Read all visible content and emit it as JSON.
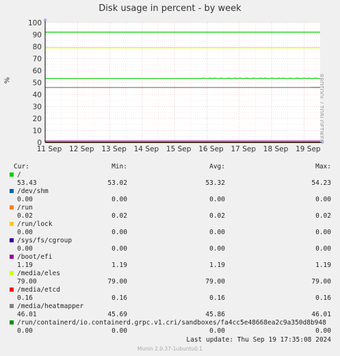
{
  "chart_data": {
    "type": "line",
    "title": "Disk usage in percent - by week",
    "ylabel": "%",
    "ylim": [
      0,
      100
    ],
    "yticks": [
      "0",
      "10",
      "20",
      "30",
      "40",
      "50",
      "60",
      "70",
      "80",
      "90",
      "100"
    ],
    "xticks": [
      "11 Sep",
      "12 Sep",
      "13 Sep",
      "14 Sep",
      "15 Sep",
      "16 Sep",
      "17 Sep",
      "18 Sep",
      "19 Sep"
    ],
    "side_label": "RRDTOOL / TOBI OETIKER",
    "legend_header": {
      "cur": "Cur:",
      "min": "Min:",
      "avg": "Avg:",
      "max": "Max:"
    },
    "series": [
      {
        "name": "/",
        "color": "#00cc00",
        "cur": "53.43",
        "min": "53.02",
        "avg": "53.32",
        "max": "54.23"
      },
      {
        "name": "/dev/shm",
        "color": "#0066b3",
        "cur": "0.00",
        "min": "0.00",
        "avg": "0.00",
        "max": "0.00"
      },
      {
        "name": "/run",
        "color": "#ff8000",
        "cur": "0.02",
        "min": "0.02",
        "avg": "0.02",
        "max": "0.02"
      },
      {
        "name": "/run/lock",
        "color": "#ffcc00",
        "cur": "0.00",
        "min": "0.00",
        "avg": "0.00",
        "max": "0.00"
      },
      {
        "name": "/sys/fs/cgroup",
        "color": "#330099",
        "cur": "0.00",
        "min": "0.00",
        "avg": "0.00",
        "max": "0.00"
      },
      {
        "name": "/boot/efi",
        "color": "#990099",
        "cur": "1.19",
        "min": "1.19",
        "avg": "1.19",
        "max": "1.19"
      },
      {
        "name": "/media/eles",
        "color": "#ccff00",
        "cur": "79.00",
        "min": "79.00",
        "avg": "79.00",
        "max": "79.00"
      },
      {
        "name": "/media/etcd",
        "color": "#ff0000",
        "cur": "0.16",
        "min": "0.16",
        "avg": "0.16",
        "max": "0.16"
      },
      {
        "name": "/media/heatmapper",
        "color": "#808080",
        "cur": "46.01",
        "min": "45.69",
        "avg": "45.86",
        "max": "46.01"
      },
      {
        "name": "/run/containerd/io.containerd.grpc.v1.cri/sandboxes/fa4cc5e48668ea2c9a350d8b948",
        "color": "#008f00",
        "cur": "0.00",
        "min": "0.00",
        "avg": "0.00",
        "max": "0.00"
      }
    ],
    "extra_line": {
      "color": "#00cc00",
      "value": 92
    }
  },
  "last_update": "Last update: Thu Sep 19 17:35:08 2024",
  "munin_version": "Munin 2.0.37-1ubuntu0.1"
}
